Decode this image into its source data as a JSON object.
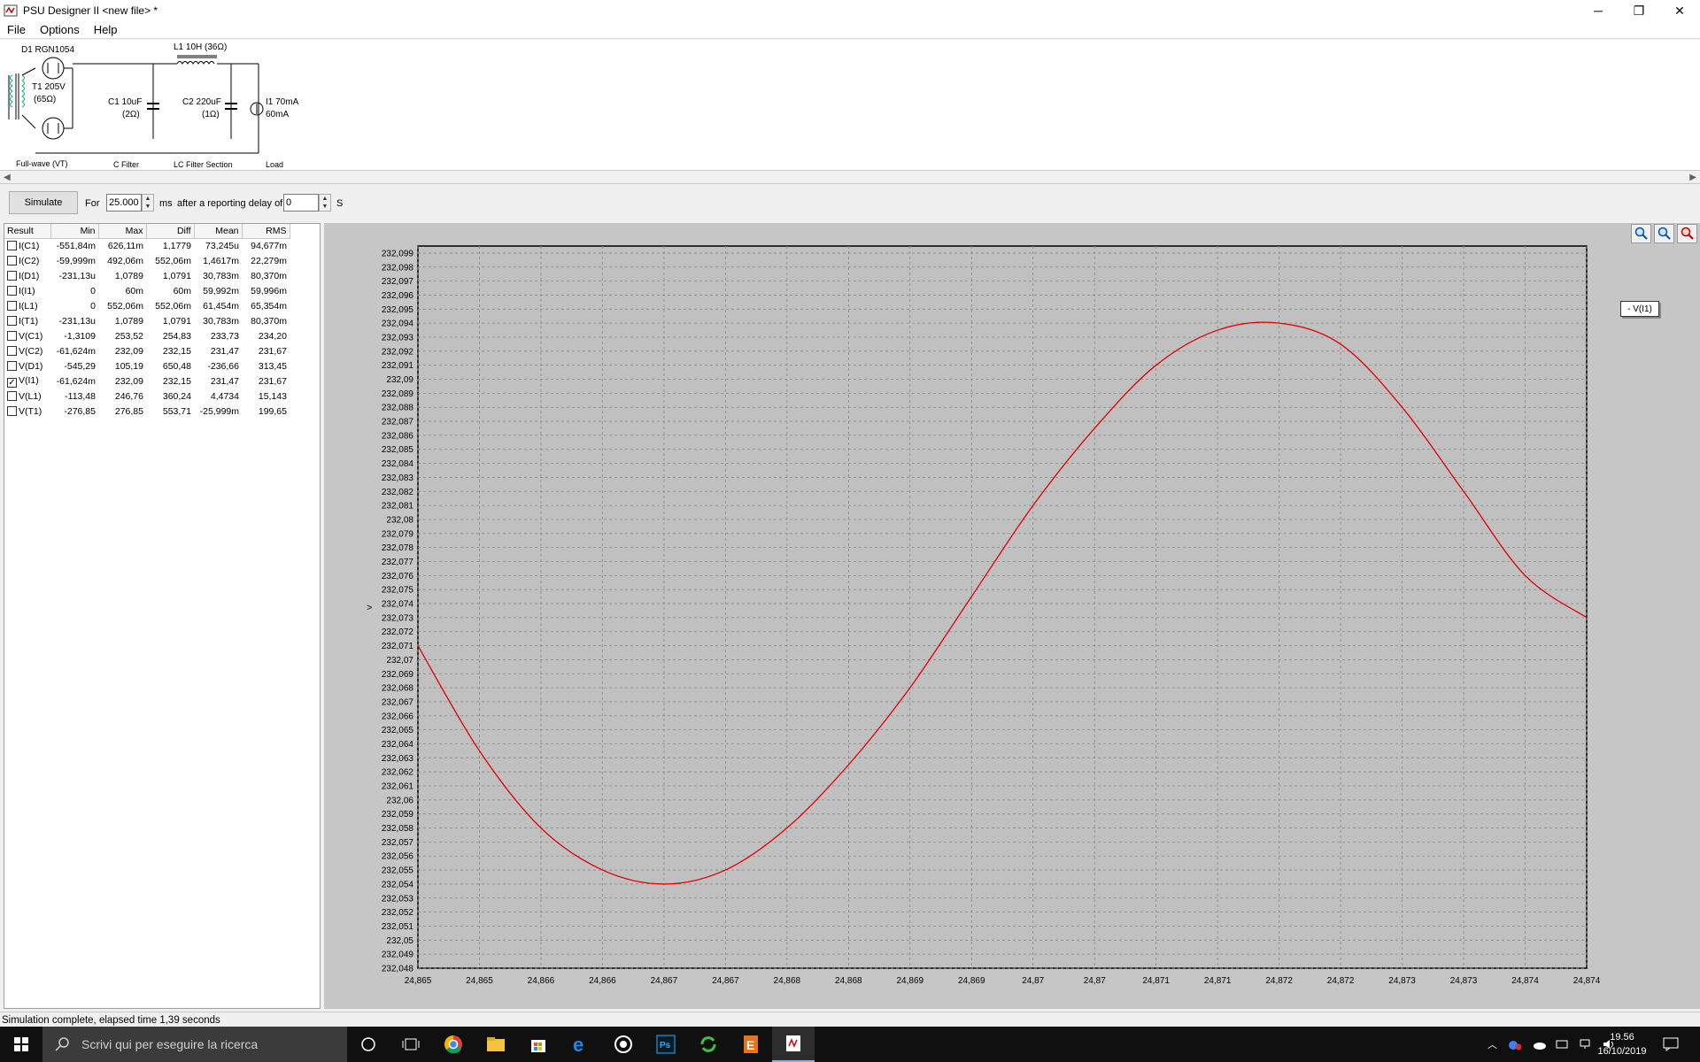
{
  "window": {
    "title": "PSU Designer II  <new file> *",
    "minimize": "─",
    "restore": "❐",
    "close": "✕"
  },
  "menu": [
    "File",
    "Options",
    "Help"
  ],
  "schematic": {
    "d1": "D1 RGN1054",
    "l1": "L1 10H (36Ω)",
    "t1_a": "T1 205V",
    "t1_b": "(65Ω)",
    "c1_a": "C1 10uF",
    "c1_b": "(2Ω)",
    "c2_a": "C2 220uF",
    "c2_b": "(1Ω)",
    "i1_a": "I1 70mA",
    "i1_b": "60mA",
    "sections": [
      "Full-wave (VT)",
      "C Filter",
      "LC Filter Section",
      "Load"
    ]
  },
  "toolbar": {
    "simulate": "Simulate",
    "for_label": "For",
    "duration": "25.000",
    "ms_label": "ms",
    "delay_label": "after a reporting delay of",
    "delay": "0",
    "s_label": "S"
  },
  "results": {
    "headers": [
      "Result",
      "Min",
      "Max",
      "Diff",
      "Mean",
      "RMS"
    ],
    "rows": [
      {
        "name": "I(C1)",
        "checked": false,
        "min": "-551,84m",
        "max": "626,11m",
        "diff": "1,1779",
        "mean": "73,245u",
        "rms": "94,677m"
      },
      {
        "name": "I(C2)",
        "checked": false,
        "min": "-59,999m",
        "max": "492,06m",
        "diff": "552,06m",
        "mean": "1,4617m",
        "rms": "22,279m"
      },
      {
        "name": "I(D1)",
        "checked": false,
        "min": "-231,13u",
        "max": "1,0789",
        "diff": "1,0791",
        "mean": "30,783m",
        "rms": "80,370m"
      },
      {
        "name": "I(I1)",
        "checked": false,
        "min": "0",
        "max": "60m",
        "diff": "60m",
        "mean": "59,992m",
        "rms": "59,996m"
      },
      {
        "name": "I(L1)",
        "checked": false,
        "min": "0",
        "max": "552,06m",
        "diff": "552,06m",
        "mean": "61,454m",
        "rms": "65,354m"
      },
      {
        "name": "I(T1)",
        "checked": false,
        "min": "-231,13u",
        "max": "1,0789",
        "diff": "1,0791",
        "mean": "30,783m",
        "rms": "80,370m"
      },
      {
        "name": "V(C1)",
        "checked": false,
        "min": "-1,3109",
        "max": "253,52",
        "diff": "254,83",
        "mean": "233,73",
        "rms": "234,20"
      },
      {
        "name": "V(C2)",
        "checked": false,
        "min": "-61,624m",
        "max": "232,09",
        "diff": "232,15",
        "mean": "231,47",
        "rms": "231,67"
      },
      {
        "name": "V(D1)",
        "checked": false,
        "min": "-545,29",
        "max": "105,19",
        "diff": "650,48",
        "mean": "-236,66",
        "rms": "313,45"
      },
      {
        "name": "V(I1)",
        "checked": true,
        "min": "-61,624m",
        "max": "232,09",
        "diff": "232,15",
        "mean": "231,47",
        "rms": "231,67"
      },
      {
        "name": "V(L1)",
        "checked": false,
        "min": "-113,48",
        "max": "246,76",
        "diff": "360,24",
        "mean": "4,4734",
        "rms": "15,143"
      },
      {
        "name": "V(T1)",
        "checked": false,
        "min": "-276,85",
        "max": "276,85",
        "diff": "553,71",
        "mean": "-25,999m",
        "rms": "199,65"
      }
    ]
  },
  "chart_data": {
    "type": "line",
    "title": "",
    "xlabel": "",
    "ylabel": ">",
    "legend": "- V(I1)",
    "xlim": [
      24.865,
      24.8745
    ],
    "ylim": [
      232.048,
      232.0995
    ],
    "grid": true,
    "y_ticks": [
      "232,099",
      "232,098",
      "232,097",
      "232,096",
      "232,095",
      "232,094",
      "232,093",
      "232,092",
      "232,091",
      "232,09",
      "232,089",
      "232,088",
      "232,087",
      "232,086",
      "232,085",
      "232,084",
      "232,083",
      "232,082",
      "232,081",
      "232,08",
      "232,079",
      "232,078",
      "232,077",
      "232,076",
      "232,075",
      "232,074",
      "232,073",
      "232,072",
      "232,071",
      "232,07",
      "232,069",
      "232,068",
      "232,067",
      "232,066",
      "232,065",
      "232,064",
      "232,063",
      "232,062",
      "232,061",
      "232,06",
      "232,059",
      "232,058",
      "232,057",
      "232,056",
      "232,055",
      "232,054",
      "232,053",
      "232,052",
      "232,051",
      "232,05",
      "232,049",
      "232,048"
    ],
    "x_ticks": [
      "24,865",
      "24,865",
      "24,866",
      "24,866",
      "24,867",
      "24,867",
      "24,868",
      "24,868",
      "24,869",
      "24,869",
      "24,87",
      "24,87",
      "24,871",
      "24,871",
      "24,872",
      "24,872",
      "24,873",
      "24,873",
      "24,874",
      "24,874"
    ],
    "series": [
      {
        "name": "V(I1)",
        "color": "#e00000",
        "x": [
          24.865,
          24.8655,
          24.866,
          24.8665,
          24.867,
          24.8675,
          24.868,
          24.8685,
          24.869,
          24.8695,
          24.87,
          24.8705,
          24.871,
          24.8715,
          24.872,
          24.8725,
          24.873,
          24.8735,
          24.874,
          24.8745
        ],
        "y": [
          232.071,
          232.0635,
          232.058,
          232.055,
          232.054,
          232.055,
          232.058,
          232.0625,
          232.068,
          232.0745,
          232.081,
          232.0865,
          232.091,
          232.0935,
          232.094,
          232.0925,
          232.088,
          232.082,
          232.076,
          232.073
        ]
      }
    ]
  },
  "status": "Simulation complete, elapsed time 1,39 seconds",
  "taskbar": {
    "search_placeholder": "Scrivi qui per eseguire la ricerca",
    "time": "19.56",
    "date": "16/10/2019"
  }
}
